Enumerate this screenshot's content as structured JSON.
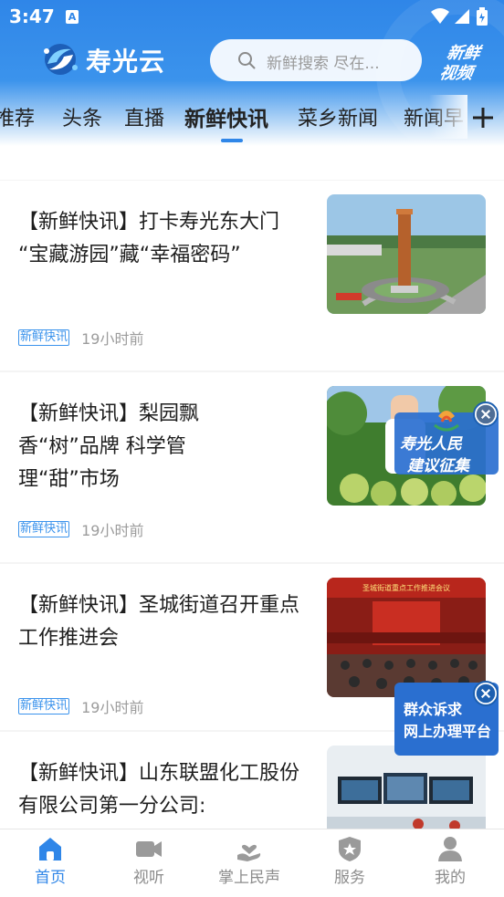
{
  "status_bar": {
    "time": "3:47",
    "app_icon": "A",
    "icons": [
      "wifi-icon",
      "signal-icon",
      "battery-icon"
    ]
  },
  "header": {
    "app_name": "寿光云",
    "search_placeholder": "新鲜搜索  尽在...",
    "video_badge": "新鲜视频"
  },
  "tabs": [
    {
      "label": "推荐",
      "active": false
    },
    {
      "label": "头条",
      "active": false
    },
    {
      "label": "直播",
      "active": false
    },
    {
      "label": "新鲜快讯",
      "active": true
    },
    {
      "label": "菜乡新闻",
      "active": false
    },
    {
      "label": "新闻早",
      "active": false
    }
  ],
  "articles": [
    {
      "title": "【新鲜快讯】打卡寿光东大门 “宝藏游园”藏“幸福密码”",
      "tag": "新鲜快讯",
      "time": "19小时前",
      "thumb": "monument-park-photo"
    },
    {
      "title": "【新鲜快讯】梨园飘香“树”品牌 科学管理“甜”市场",
      "tag": "新鲜快讯",
      "time": "19小时前",
      "thumb": "pear-orchard-photo"
    },
    {
      "title": "【新鲜快讯】圣城街道召开重点工作推进会",
      "tag": "新鲜快讯",
      "time": "19小时前",
      "thumb": "meeting-hall-photo",
      "banner": "圣城街道重点工作推进会议"
    },
    {
      "title": "【新鲜快讯】山东联盟化工股份有限公司第一分公司:",
      "tag": "",
      "time": "",
      "thumb": "control-room-photo"
    }
  ],
  "floating": {
    "suggestion_line1": "寿光人民",
    "suggestion_line2": "建议征集",
    "service_line1": "群众诉求",
    "service_line2": "网上办理平台"
  },
  "bottom_nav": [
    {
      "label": "首页",
      "icon": "home-icon",
      "active": true
    },
    {
      "label": "视听",
      "icon": "video-camera-icon",
      "active": false
    },
    {
      "label": "掌上民声",
      "icon": "hand-heart-icon",
      "active": false
    },
    {
      "label": "服务",
      "icon": "shield-service-icon",
      "active": false
    },
    {
      "label": "我的",
      "icon": "user-icon",
      "active": false
    }
  ],
  "colors": {
    "brand_blue": "#2f86e8",
    "tag_blue": "#3b93ec",
    "muted_text": "#9c9c9c"
  }
}
